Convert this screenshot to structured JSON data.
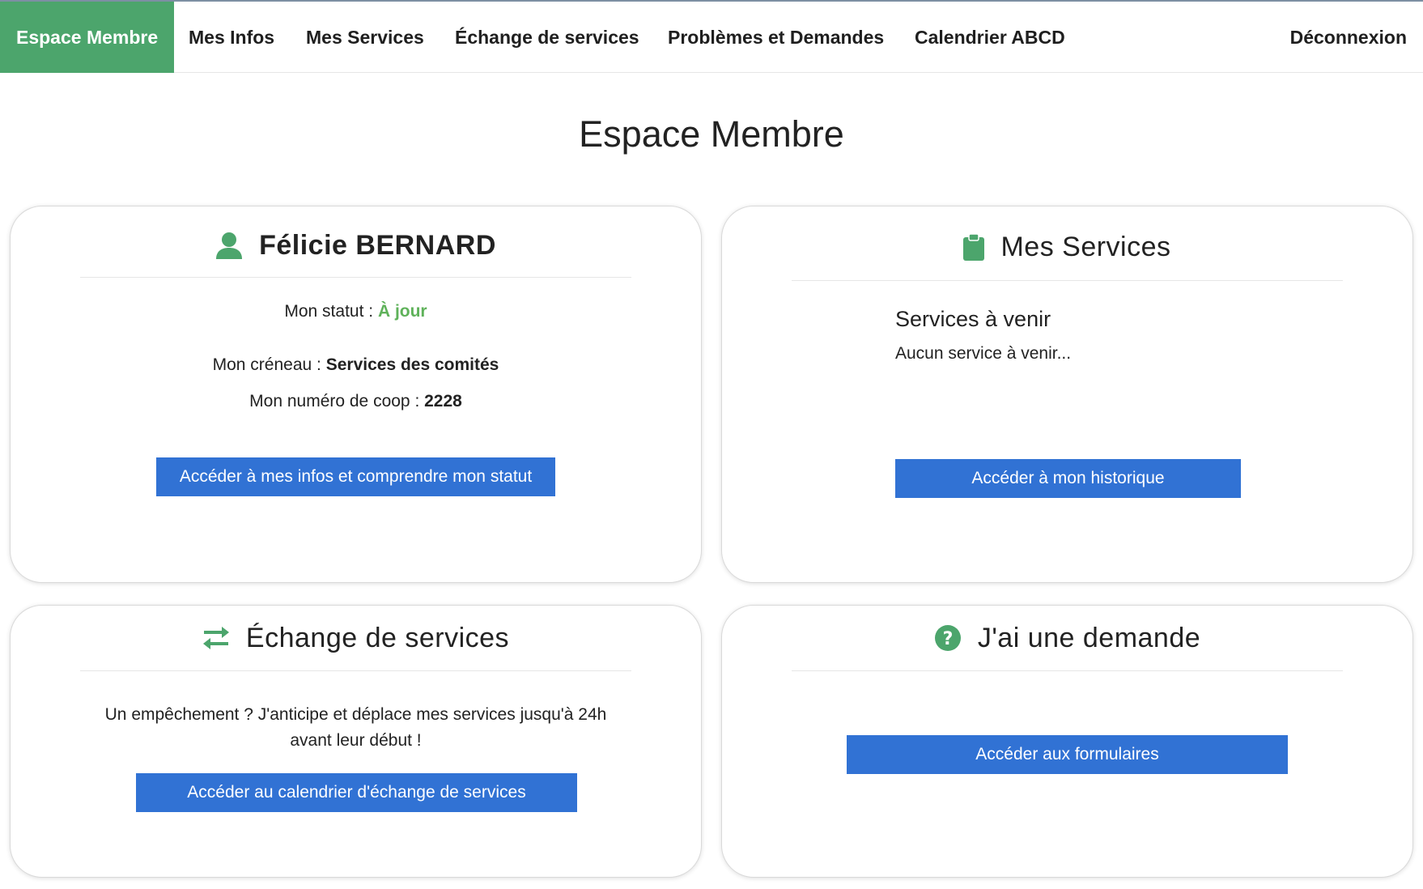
{
  "nav": {
    "items": [
      {
        "label": "Espace Membre"
      },
      {
        "label": "Mes Infos"
      },
      {
        "label": "Mes Services"
      },
      {
        "label": "Échange de services"
      },
      {
        "label": "Problèmes et Demandes"
      },
      {
        "label": "Calendrier ABCD"
      }
    ],
    "logout": "Déconnexion"
  },
  "page": {
    "title": "Espace Membre"
  },
  "profile": {
    "icon": "user-icon",
    "name": "Félicie BERNARD",
    "status_label": "Mon statut : ",
    "status_value": "À jour",
    "slot_label": "Mon créneau : ",
    "slot_value": "Services des comités",
    "coop_label": "Mon numéro de coop : ",
    "coop_value": "2228",
    "button": "Accéder à mes infos et comprendre mon statut"
  },
  "services": {
    "icon": "clipboard-icon",
    "title": "Mes Services",
    "upcoming_heading": "Services à venir",
    "upcoming_empty": "Aucun service à venir...",
    "button": "Accéder à mon historique"
  },
  "exchange": {
    "icon": "exchange-arrows-icon",
    "title": "Échange de services",
    "text_line1": "Un empêchement ? J'anticipe et déplace mes services jusqu'à 24h",
    "text_line2": "avant leur début !",
    "button": "Accéder au calendrier d'échange de services"
  },
  "request": {
    "icon": "question-circle-icon",
    "title": "J'ai une demande",
    "button": "Accéder aux formulaires"
  },
  "colors": {
    "brand_green": "#4ca56c",
    "icon_green": "#4ca56c",
    "status_ok": "#5fb25a",
    "button_blue": "#3172d4"
  }
}
